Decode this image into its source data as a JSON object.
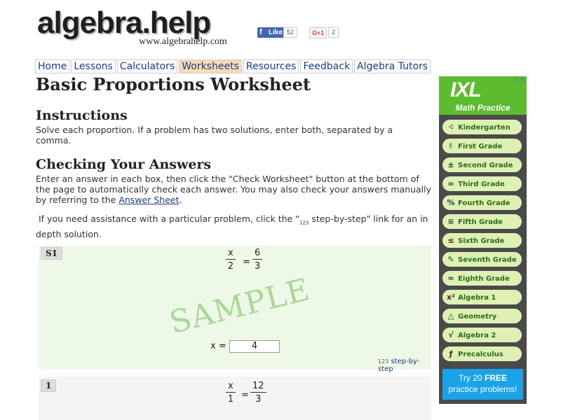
{
  "header": {
    "logo": "algebra.help",
    "url": "www.algebrahelp.com",
    "fb_like": "Like",
    "fb_count": "52",
    "gplus": "G+1",
    "gplus_count": "2"
  },
  "nav": [
    "Home",
    "Lessons",
    "Calculators",
    "Worksheets",
    "Resources",
    "Feedback",
    "Algebra Tutors"
  ],
  "page": {
    "title": "Basic Proportions Worksheet",
    "instructions_heading": "Instructions",
    "instructions_text": "Solve each proportion.  If a problem has two solutions, enter both, separated by a comma.",
    "checking_heading": "Checking Your Answers",
    "checking_text_before": "Enter an answer in each box, then click the \"Check Worksheet\" button at the bottom of the page to automatically check each answer.  You may also check your answers manually by referring to the ",
    "answer_sheet_link": "Answer Sheet",
    "checking_text_after": ".",
    "assist_before": "If you need assistance with a particular problem, click the \"",
    "assist_icon": "123",
    "assist_after": " step-by-step\" link for an in depth solution."
  },
  "problems": [
    {
      "label": "S1",
      "left_num": "x",
      "left_den": "2",
      "right_num": "6",
      "right_den": "3",
      "watermark": "SAMPLE",
      "answer_label": "x =",
      "answer_value": "4",
      "step_icon": "123",
      "step_link": "step-by-step"
    },
    {
      "label": "1",
      "left_num": "x",
      "left_den": "1",
      "right_num": "12",
      "right_den": "3"
    }
  ],
  "equals": "=",
  "ad": {
    "brand": "IXL",
    "subtitle": "Math Practice",
    "grades": [
      {
        "icon": "dots-icon",
        "glyph": "⁖",
        "label": "Kindergarten"
      },
      {
        "icon": "hand-icon",
        "glyph": "✌",
        "label": "First Grade"
      },
      {
        "icon": "plus-minus-icon",
        "glyph": "±",
        "label": "Second Grade"
      },
      {
        "icon": "infinity-icon",
        "glyph": "∞",
        "label": "Third Grade"
      },
      {
        "icon": "percent-icon",
        "glyph": "%",
        "label": "Fourth Grade"
      },
      {
        "icon": "stack-icon",
        "glyph": "≡",
        "label": "Fifth Grade"
      },
      {
        "icon": "less-equal-icon",
        "glyph": "≤",
        "label": "Sixth Grade"
      },
      {
        "icon": "pencil-icon",
        "glyph": "✎",
        "label": "Seventh Grade"
      },
      {
        "icon": "approx-icon",
        "glyph": "≈",
        "label": "Eighth Grade"
      },
      {
        "icon": "x-squared-icon",
        "glyph": "x²",
        "label": "Algebra 1"
      },
      {
        "icon": "triangle-icon",
        "glyph": "△",
        "label": "Geometry"
      },
      {
        "icon": "sqrt-icon",
        "glyph": "√",
        "label": "Algebra 2"
      },
      {
        "icon": "function-icon",
        "glyph": "ƒ",
        "label": "Precalculus"
      }
    ],
    "cta_line1_before": "Try 20 ",
    "cta_line1_bold": "FREE",
    "cta_line2": "practice problems!"
  },
  "colors": {
    "problem_sample_bg": "#eef8e6",
    "problem_bg": "#f4f4f4",
    "link": "#1a3a8a",
    "nav_active": "#f6ddb0"
  }
}
